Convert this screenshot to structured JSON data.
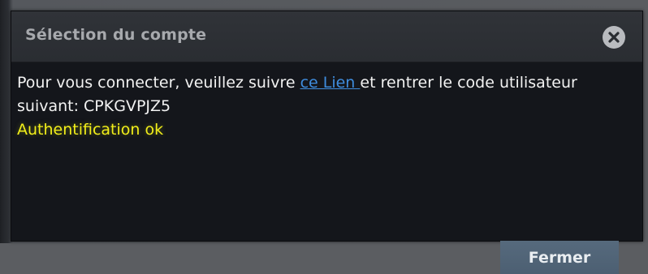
{
  "dialog": {
    "title": "Sélection du compte",
    "close_icon": "close-circle-icon"
  },
  "message": {
    "prefix": "Pour vous connecter, veuillez suivre ",
    "link_label": "ce Lien ",
    "suffix": "et rentrer le code utilisateur suivant: CPKGVPJZ5",
    "status": "Authentification ok"
  },
  "footer": {
    "close_label": "Fermer"
  },
  "colors": {
    "link": "#3f8dde",
    "status": "#f2ee1a",
    "button": "#566a7d"
  }
}
